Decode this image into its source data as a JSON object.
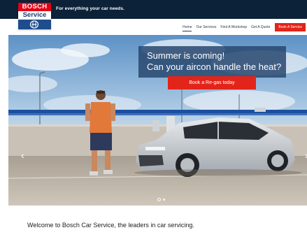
{
  "brand": {
    "logo_top": "BOSCH",
    "logo_bottom": "Service",
    "tagline": "For everything your car needs."
  },
  "nav": {
    "items": [
      "Home",
      "Our Services",
      "Find A Workshop",
      "Get A Quote"
    ],
    "active": "Home",
    "cta": "Book A Service"
  },
  "hero": {
    "headline_1": "Summer is coming!",
    "headline_2": "Can your aircon handle the heat?",
    "button": "Book a Re-gas today",
    "prev_arrow": "‹",
    "next_arrow": "›",
    "slides_total": 2,
    "active_slide": 1
  },
  "welcome": "Welcome to Bosch Car Service, the leaders in car servicing.",
  "colors": {
    "navy": "#0b2238",
    "red": "#e2241a",
    "bosch_red": "#e20015",
    "promo_blue": "#28486e"
  }
}
